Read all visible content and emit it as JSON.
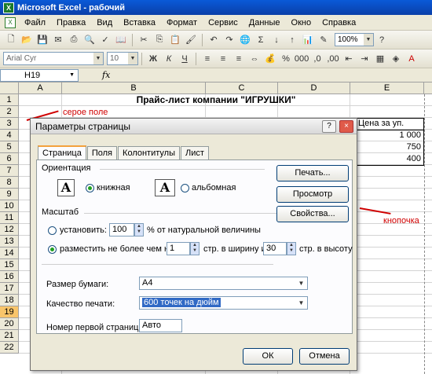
{
  "window": {
    "title": "Microsoft Excel - рабочий",
    "app_icon": "excel-icon"
  },
  "menu": [
    "Файл",
    "Правка",
    "Вид",
    "Вставка",
    "Формат",
    "Сервис",
    "Данные",
    "Окно",
    "Справка"
  ],
  "toolbar1": {
    "zoom": "100%"
  },
  "toolbar2": {
    "font": "Arial Cyr",
    "size": "10"
  },
  "formula_bar": {
    "name_box": "H19",
    "fx": "fx"
  },
  "columns": [
    "A",
    "B",
    "C",
    "D",
    "E"
  ],
  "rows": [
    "1",
    "2",
    "3",
    "4",
    "5",
    "6",
    "7",
    "8",
    "9",
    "10",
    "11",
    "12",
    "13",
    "14",
    "15",
    "16",
    "17",
    "18",
    "19",
    "20",
    "21",
    "22"
  ],
  "selected_row": "19",
  "sheet": {
    "title": "Прайс-лист компании \"ИГРУШКИ\"",
    "price_header": "Цена за уп.",
    "prices": [
      "1 000",
      "750",
      "400"
    ]
  },
  "annotations": {
    "gray_field": "серое поле",
    "button": "кнопочка",
    "color": "#d00000"
  },
  "dialog": {
    "title": "Параметры страницы",
    "help_btn": "?",
    "close_btn": "×",
    "tabs": [
      "Страница",
      "Поля",
      "Колонтитулы",
      "Лист"
    ],
    "orientation_label": "Ориентация",
    "portrait": "книжная",
    "landscape": "альбомная",
    "scale_label": "Масштаб",
    "set_label": "установить:",
    "set_value": "100",
    "set_suffix": "% от натуральной величины",
    "fit_label": "разместить не более чем на:",
    "fit_width": "1",
    "fit_width_suffix": "стр. в ширину и",
    "fit_height": "30",
    "fit_height_suffix": "стр. в высоту",
    "paper_label": "Размер бумаги:",
    "paper_value": "A4",
    "quality_label": "Качество печати:",
    "quality_value": "600 точек на дюйм",
    "first_page_label": "Номер первой страницы:",
    "first_page_value": "Авто",
    "print_btn": "Печать...",
    "preview_btn": "Просмотр",
    "props_btn": "Свойства...",
    "ok_btn": "ОК",
    "cancel_btn": "Отмена"
  }
}
